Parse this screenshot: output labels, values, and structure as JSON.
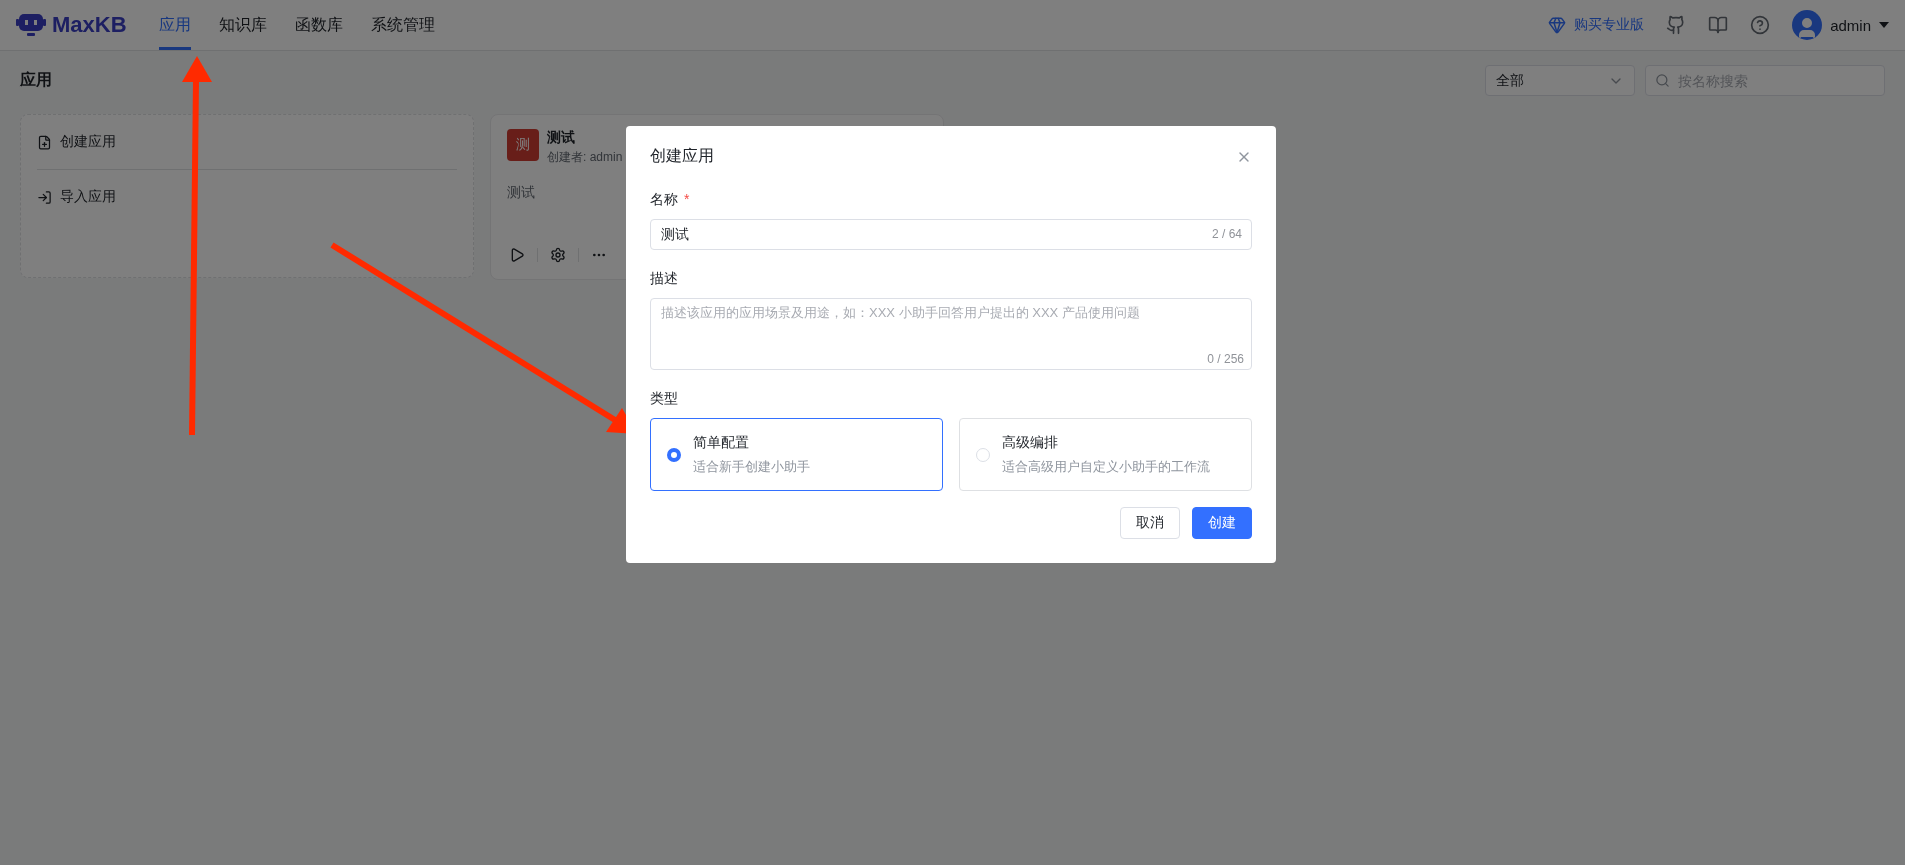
{
  "header": {
    "logo": "MaxKB",
    "nav": [
      {
        "label": "应用",
        "selected": true
      },
      {
        "label": "知识库",
        "selected": false
      },
      {
        "label": "函数库",
        "selected": false
      },
      {
        "label": "系统管理",
        "selected": false
      }
    ],
    "upgrade": "购买专业版",
    "user": "admin"
  },
  "page": {
    "title": "应用",
    "filter": "全部",
    "search": {
      "placeholder": "按名称搜索"
    }
  },
  "create_card": {
    "actions": [
      "创建应用",
      "导入应用"
    ]
  },
  "apps": [
    {
      "avatar": "测",
      "name": "测试",
      "creator": "创建者: admin",
      "description": "测试"
    }
  ],
  "dialog": {
    "title": "创建应用",
    "name": {
      "label": "名称",
      "required_mark": "*",
      "value": "测试",
      "count": "2 / 64"
    },
    "description": {
      "label": "描述",
      "placeholder": "描述该应用的应用场景及用途，如：XXX 小助手回答用户提出的 XXX 产品使用问题",
      "count": "0 / 256"
    },
    "type": {
      "label": "类型",
      "options": [
        {
          "title": "简单配置",
          "subtitle": "适合新手创建小助手",
          "selected": true
        },
        {
          "title": "高级编排",
          "subtitle": "适合高级用户自定义小助手的工作流",
          "selected": false
        }
      ]
    },
    "buttons": [
      {
        "label": "取消",
        "kind": "secondary"
      },
      {
        "label": "创建",
        "kind": "primary"
      }
    ]
  }
}
